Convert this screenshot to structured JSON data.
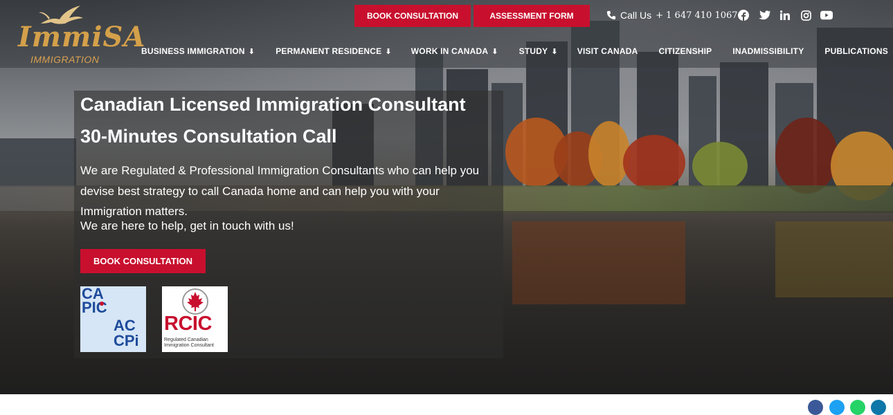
{
  "header": {
    "logo": {
      "main": "ImmiSA",
      "sub": "IMMIGRATION"
    },
    "top_buttons": [
      "BOOK CONSULTATION",
      "ASSESSMENT FORM"
    ],
    "call": {
      "label": "Call Us",
      "number": "+ 1 647 410 1067"
    },
    "social_icons": [
      "facebook-icon",
      "twitter-icon",
      "linkedin-icon",
      "instagram-icon",
      "youtube-icon"
    ],
    "nav": [
      {
        "label": "BUSINESS IMMIGRATION",
        "dropdown": true
      },
      {
        "label": "PERMANENT RESIDENCE",
        "dropdown": true
      },
      {
        "label": "WORK IN CANADA",
        "dropdown": true
      },
      {
        "label": "STUDY",
        "dropdown": true
      },
      {
        "label": "VISIT CANADA",
        "dropdown": false
      },
      {
        "label": "CITIZENSHIP",
        "dropdown": false
      },
      {
        "label": "INADMISSIBILITY",
        "dropdown": false
      },
      {
        "label": "PUBLICATIONS",
        "dropdown": true
      }
    ]
  },
  "hero": {
    "title1": "Canadian Licensed Immigration Consultant",
    "title2": "30-Minutes Consultation Call",
    "paragraph": "We are Regulated & Professional Immigration Consultants who can help you devise best strategy to call Canada home and can help you with your Immigration matters.",
    "paragraph2": "We are here to help, get in touch with us!",
    "cta": "BOOK CONSULTATION",
    "badges": {
      "capic": {
        "line1": "CA",
        "line2": "PIC",
        "line3": "AC",
        "line4": "CPi"
      },
      "rcic": {
        "main": "RCIC",
        "sub1": "Regulated Canadian",
        "sub2": "Immigration Consultant"
      }
    }
  },
  "share_icons": [
    "facebook-icon",
    "twitter-icon",
    "whatsapp-icon",
    "linkedin-icon"
  ],
  "colors": {
    "accent_red": "#c8102e",
    "logo_gold": "#d4a04a",
    "header_overlay": "#373a3e"
  }
}
